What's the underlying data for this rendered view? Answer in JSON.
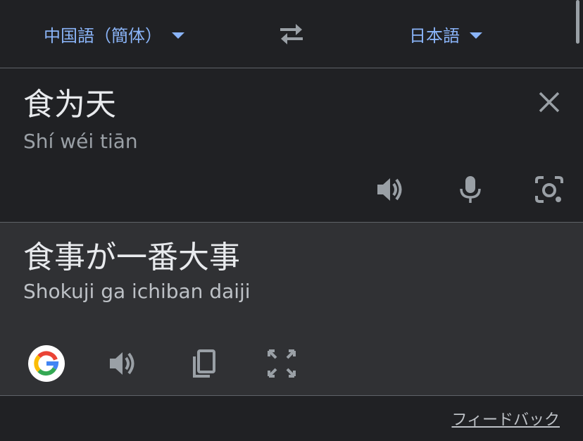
{
  "language_bar": {
    "source_language": "中国語（簡体）",
    "target_language": "日本語",
    "caret_icon": "caret-down-icon",
    "swap_icon": "swap-horiz-icon"
  },
  "source": {
    "text": "食为天",
    "romanization": "Shí wéi tiān",
    "clear_icon": "close-icon",
    "speaker_icon": "volume-icon",
    "mic_icon": "microphone-icon",
    "camera_icon": "camera-icon"
  },
  "translation": {
    "text": "食事が一番大事",
    "romanization": "Shokuji ga ichiban daiji",
    "google_icon": "google-g-icon",
    "speaker_icon": "volume-icon",
    "copy_icon": "copy-icon",
    "fullscreen_icon": "fullscreen-icon"
  },
  "footer": {
    "feedback_label": "フィードバック"
  },
  "colors": {
    "background": "#202124",
    "translation_background": "#303134",
    "accent": "#8ab4f8",
    "divider": "#5f6368",
    "icon": "#9aa0a6"
  }
}
